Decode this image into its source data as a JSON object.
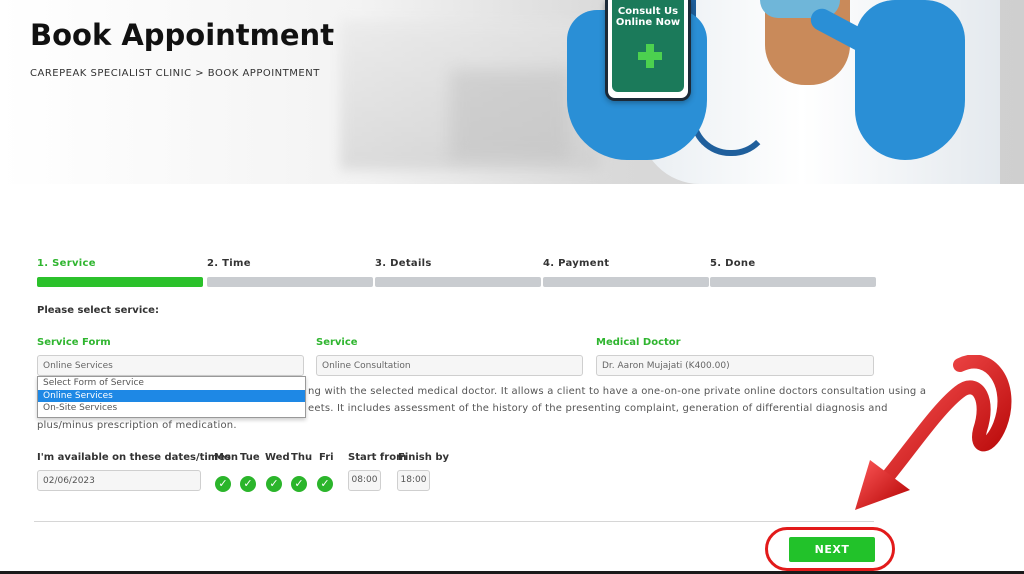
{
  "header": {
    "title": "Book Appointment",
    "breadcrumb": "CAREPEAK SPECIALIST CLINIC > BOOK APPOINTMENT",
    "phone_text_line1": "Consult Us",
    "phone_text_line2": "Online Now"
  },
  "steps": [
    {
      "label": "1. Service",
      "active": true
    },
    {
      "label": "2. Time",
      "active": false
    },
    {
      "label": "3. Details",
      "active": false
    },
    {
      "label": "4. Payment",
      "active": false
    },
    {
      "label": "5. Done",
      "active": false
    }
  ],
  "form": {
    "heading": "Please select service:",
    "service_form": {
      "label": "Service Form",
      "value": "Online Services",
      "options": [
        "Select Form of Service",
        "Online Services",
        "On-Site Services"
      ]
    },
    "service": {
      "label": "Service",
      "value": "Online Consultation"
    },
    "doctor": {
      "label": "Medical Doctor",
      "value": "Dr. Aaron Mujajati (K400.00)"
    },
    "description": {
      "line1": "ng with the selected medical doctor. It allows a client to have a one-on-one private online doctors consultation using a",
      "line2": "eets. It includes assessment of the history of the presenting complaint, generation of differential diagnosis and",
      "line3": "plus/minus prescription of medication."
    }
  },
  "availability": {
    "label": "I'm available on these dates/times",
    "date": "02/06/2023",
    "days": [
      "Mon",
      "Tue",
      "Wed",
      "Thu",
      "Fri"
    ],
    "check_glyph": "✓",
    "start_label": "Start from",
    "finish_label": "Finish by",
    "start_time": "08:00",
    "finish_time": "18:00"
  },
  "actions": {
    "next_label": "NEXT"
  },
  "colors": {
    "accent_green": "#2bc12b",
    "highlight_red": "#e21a1a",
    "selected_blue": "#1e88e5"
  }
}
